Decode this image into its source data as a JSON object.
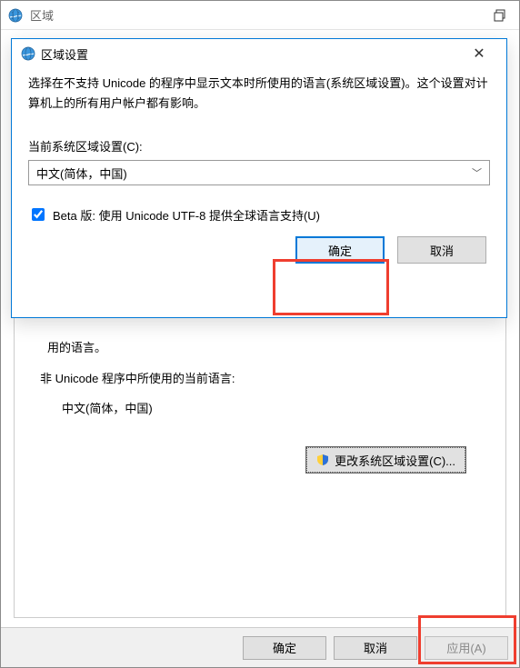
{
  "parent": {
    "title": "区域",
    "truncated_text": "用的语言。",
    "non_unicode": {
      "heading": "非 Unicode 程序中所使用的当前语言:",
      "language": "中文(简体，中国)",
      "change_btn": "更改系统区域设置(C)..."
    },
    "footer": {
      "ok": "确定",
      "cancel": "取消",
      "apply": "应用(A)"
    }
  },
  "child": {
    "title": "区域设置",
    "description": "选择在不支持 Unicode 的程序中显示文本时所使用的语言(系统区域设置)。这个设置对计算机上的所有用户帐户都有影响。",
    "field_label": "当前系统区域设置(C):",
    "selected_locale": "中文(简体，中国)",
    "beta_checkbox_label": "Beta 版: 使用 Unicode UTF-8 提供全球语言支持(U)",
    "ok": "确定",
    "cancel": "取消"
  }
}
